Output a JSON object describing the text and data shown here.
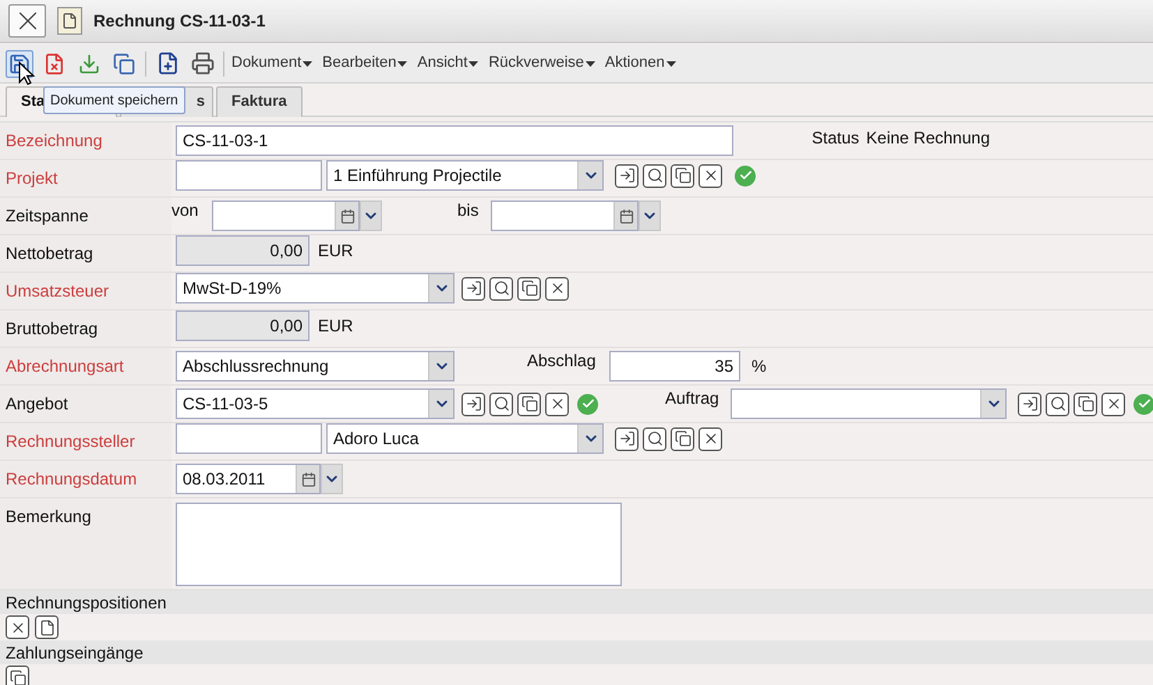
{
  "window": {
    "title": "Rechnung CS-11-03-1"
  },
  "toolbar": {
    "menus": [
      "Dokument",
      "Bearbeiten",
      "Ansicht",
      "Rückverweise",
      "Aktionen"
    ]
  },
  "tooltip": "Dokument speichern",
  "tabs": [
    {
      "label": "Sta",
      "selected": true
    },
    {
      "label": "s",
      "selected": false
    },
    {
      "label": "Faktura",
      "selected": false
    }
  ],
  "status": {
    "label": "Status",
    "value": "Keine Rechnung"
  },
  "fields": [
    {
      "kind": "text",
      "label": "Bezeichnung",
      "required": true,
      "value": "CS-11-03-1"
    },
    {
      "kind": "lookup",
      "label": "Projekt",
      "required": true,
      "value": "1 Einführung Projectile",
      "valid": true
    },
    {
      "kind": "daterange",
      "label": "Zeitspanne",
      "required": false,
      "from_label": "von",
      "to_label": "bis"
    },
    {
      "kind": "amount",
      "label": "Nettobetrag",
      "required": false,
      "value": "0,00",
      "unit": "EUR"
    },
    {
      "kind": "select",
      "label": "Umsatzsteuer",
      "required": true,
      "value": "MwSt-D-19%",
      "valid": false
    },
    {
      "kind": "amount",
      "label": "Bruttobetrag",
      "required": false,
      "value": "0,00",
      "unit": "EUR"
    },
    {
      "kind": "select_pct",
      "label": "Abrechnungsart",
      "required": true,
      "value": "Abschlussrechnung",
      "extra_label": "Abschlag",
      "extra_value": "35",
      "unit": "%"
    },
    {
      "kind": "select_pair",
      "label": "Angebot",
      "required": false,
      "value": "CS-11-03-5",
      "valid": true,
      "extra_label": "Auftrag",
      "extra_valid": true
    },
    {
      "kind": "lookup",
      "label": "Rechnungssteller",
      "required": true,
      "value": "Adoro Luca",
      "valid": false
    },
    {
      "kind": "date",
      "label": "Rechnungsdatum",
      "required": true,
      "value": "08.03.2011"
    },
    {
      "kind": "textarea",
      "label": "Bemerkung",
      "required": false
    }
  ],
  "sections": [
    {
      "title": "Rechnungspositionen"
    },
    {
      "title": "Zahlungseingänge"
    }
  ]
}
